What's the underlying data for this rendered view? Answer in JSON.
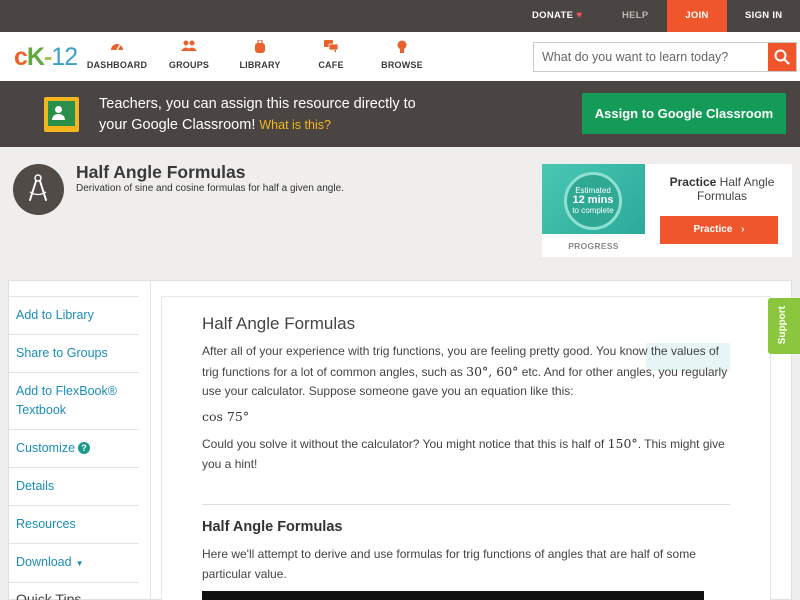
{
  "topbar": {
    "donate": "DONATE",
    "help": "HELP",
    "join": "JOIN",
    "signin": "SIGN IN"
  },
  "nav": {
    "logo": {
      "c": "c",
      "k": "K",
      "dash": "-",
      "num": "12"
    },
    "items": [
      {
        "label": "DASHBOARD",
        "icon": "gauge-icon"
      },
      {
        "label": "GROUPS",
        "icon": "people-icon"
      },
      {
        "label": "LIBRARY",
        "icon": "bookbag-icon"
      },
      {
        "label": "CAFE",
        "icon": "chat-bubbles-icon"
      },
      {
        "label": "BROWSE",
        "icon": "lightbulb-icon"
      }
    ],
    "search_placeholder": "What do you want to learn today?"
  },
  "classroom_banner": {
    "line1": "Teachers, you can assign this resource directly to",
    "line2": "your Google Classroom!",
    "what": "What is this?",
    "button": "Assign to Google Classroom"
  },
  "header": {
    "title": "Half Angle Formulas",
    "subtitle": "Derivation of sine and cosine formulas for half a given angle."
  },
  "practice": {
    "estimated": "Estimated",
    "mins": "12 mins",
    "complete": "to complete",
    "progress": "PROGRESS",
    "title_bold": "Practice",
    "title_rest": " Half Angle Formulas",
    "button": "Practice"
  },
  "sidebar": {
    "items": [
      {
        "label": "Add to Library"
      },
      {
        "label": "Share to Groups"
      },
      {
        "label": "Add to FlexBook® Textbook"
      },
      {
        "label": "Customize"
      },
      {
        "label": "Details"
      },
      {
        "label": "Resources"
      },
      {
        "label": "Download"
      }
    ],
    "quick_tips": "Quick Tips"
  },
  "article": {
    "title": "Half Angle Formulas",
    "p1_a": "After all of your experience with trig functions, you are feeling pretty good. You know the values of trig functions for a lot of common angles, such as ",
    "p1_math": "30°, 60°",
    "p1_b": " etc. And for other angles, you regularly use your calculator. Suppose someone gave you an equation like this:",
    "eq": "cos 75°",
    "p2_a": "Could you solve it without the calculator? You might notice that this is half of ",
    "p2_math": "150°",
    "p2_b": ". This might give you a hint!",
    "h2": "Half Angle Formulas",
    "p3": "Here we'll attempt to derive and use formulas for trig functions of angles that are half of some particular value."
  },
  "support": "Support",
  "colors": {
    "orange": "#f0562c",
    "dark": "#4a4542",
    "green": "#149b57",
    "link": "#1a8db8",
    "support_green": "#8cc63e"
  }
}
